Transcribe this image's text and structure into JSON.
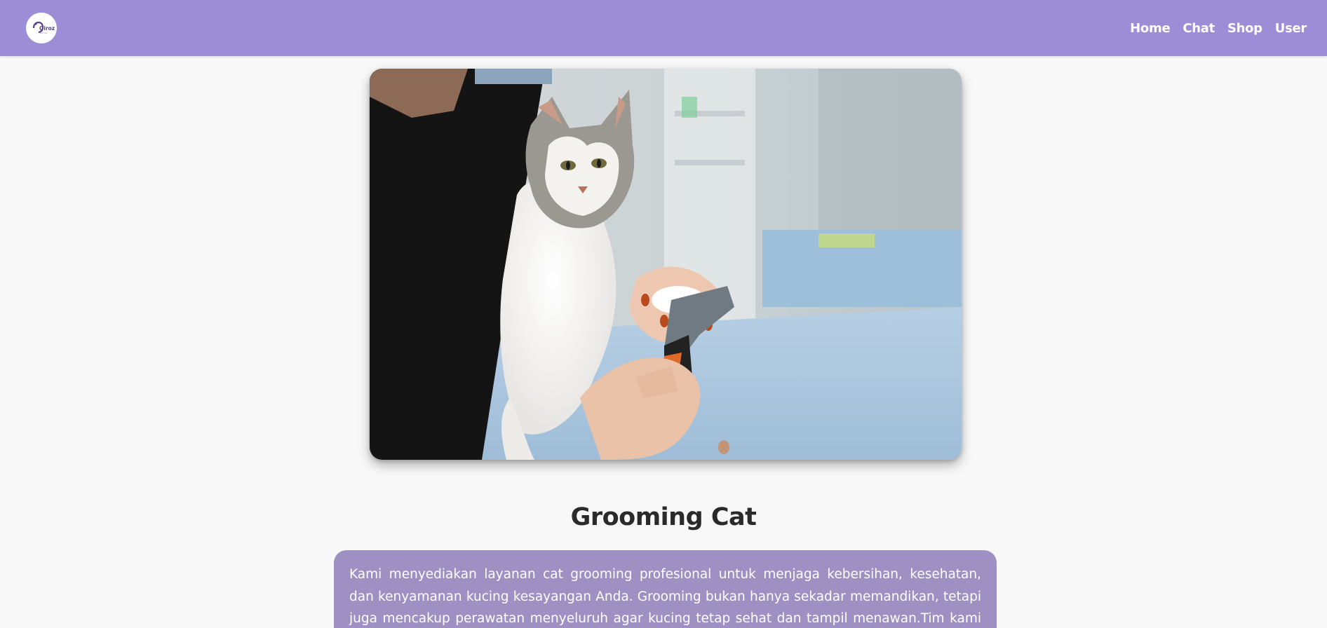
{
  "header": {
    "logo": {
      "icon": "brand-logo-icon",
      "text": "Qiroz"
    },
    "nav": [
      {
        "label": "Home"
      },
      {
        "label": "Chat"
      },
      {
        "label": "Shop"
      },
      {
        "label": "User"
      }
    ]
  },
  "hero": {
    "icon": "cat-grooming-photo"
  },
  "content": {
    "title": "Grooming Cat",
    "description": "Kami menyediakan layanan cat grooming profesional untuk menjaga kebersihan, kesehatan, dan kenyamanan kucing kesayangan Anda. Grooming bukan hanya sekadar memandikan, tetapi juga mencakup perawatan menyeluruh agar kucing tetap sehat dan tampil menawan.Tim kami yang"
  },
  "colors": {
    "navbar": "#9b8dd6",
    "card": "#9e90c2",
    "background": "#f8f8f8",
    "title": "#2a2a2a"
  }
}
